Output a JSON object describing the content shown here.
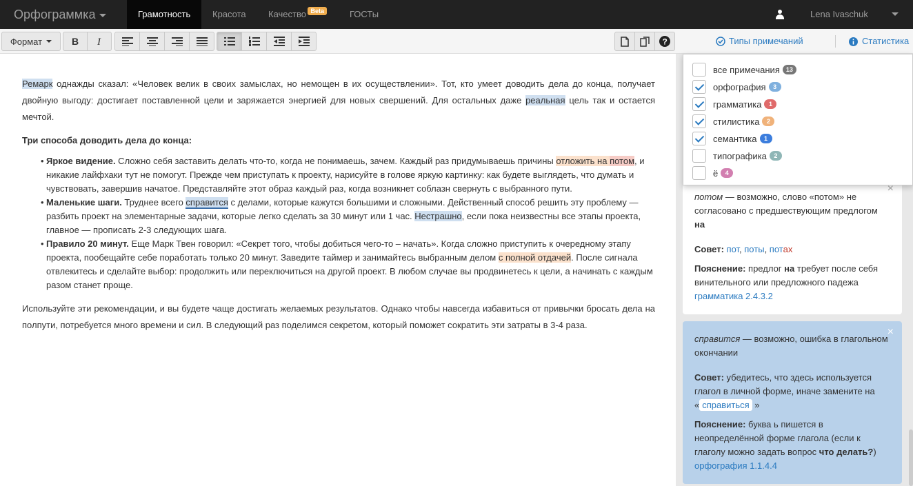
{
  "nav": {
    "brand": "Орфограммка",
    "tabs": [
      {
        "label": "Грамотность"
      },
      {
        "label": "Красота"
      },
      {
        "label": "Качество"
      },
      {
        "label": "ГОСТы"
      }
    ],
    "beta_badge": "Beta",
    "user_name": "Lena Ivaschuk"
  },
  "toolbar": {
    "format_label": "Формат",
    "buttons": [
      "bold",
      "italic",
      "align-left",
      "align-center",
      "align-right",
      "align-justify",
      "bullet-list",
      "numbered-list",
      "outdent",
      "indent"
    ],
    "comment_types_label": "Типы примечаний",
    "stats_label": "Статистика"
  },
  "editor": {
    "p1": {
      "w1": "Ремарк",
      "t1": " однажды сказал: «Человек велик в своих замыслах, но немощен в их осуществлении». Тот, кто умеет доводить дела до конца, получает двойную выгоду: достигает поставленной цели и заряжается энергией для новых свершений. Для остальных даже ",
      "w2": "реальная",
      "t2": " цель так и остается мечтой."
    },
    "heading": "Три способа доводить дела до конца:",
    "bullets": [
      {
        "bold": "Яркое видение.",
        "t1": " Сложно себя заставить делать что-то, когда не понимаешь, зачем. Каждый раз придумываешь причины ",
        "w1": "отложить на ",
        "w2": "потом",
        "t2": ", и никакие лайфхаки тут не помогут. Прежде чем приступать к проекту, нарисуйте в голове яркую картинку: как будете выглядеть, что думать и чувствовать, завершив начатое. Представляйте этот образ каждый раз, когда возникнет соблазн свернуть с выбранного пути."
      },
      {
        "bold": "Маленькие шаги.",
        "t1": " Труднее всего ",
        "w1": "справится",
        "t2": " с делами, которые кажутся большими и сложными. Действенный способ решить эту проблему — разбить проект на элементарные задачи, которые легко сделать за 30 минут или 1 час. ",
        "w2": "Нестрашно",
        "t3": ", если пока неизвестны все этапы проекта, главное — прописать 2-3 следующих шага."
      },
      {
        "bold": "Правило 20 минут.",
        "t1": " Еще Марк Твен говорил: «Секрет того, чтобы добиться чего-то – начать». Когда сложно приступить к очередному этапу проекта, пообещайте себе поработать только 20 минут. Заведите таймер и занимайтесь выбранным делом ",
        "w1": "с полной отдачей",
        "t2": ". После сигнала отвлекитесь и сделайте выбор: продолжить или переключиться на другой проект. В любом случае вы продвинетесь к цели, а начинать с каждым разом станет проще."
      }
    ],
    "p3": "Используйте эти рекомендации, и вы будете чаще достигать желаемых результатов. Однако чтобы навсегда избавиться от привычки бросать дела на полпути, потребуется много времени и сил. В следующий раз поделимся секретом, который поможет сократить эти затраты в 3-4 раза."
  },
  "filter": {
    "items": [
      {
        "label": "все примечания",
        "count": "13",
        "checked": false,
        "color": "#777777"
      },
      {
        "label": "орфография",
        "count": "3",
        "checked": true,
        "color": "#7fb0de"
      },
      {
        "label": "грамматика",
        "count": "1",
        "checked": true,
        "color": "#e06b6b"
      },
      {
        "label": "стилистика",
        "count": "2",
        "checked": true,
        "color": "#f0b27a"
      },
      {
        "label": "семантика",
        "count": "1",
        "checked": true,
        "color": "#3b7ddd"
      },
      {
        "label": "типографика",
        "count": "2",
        "checked": false,
        "color": "#8fb6b6"
      },
      {
        "label": "ё",
        "count": "4",
        "checked": false,
        "color": "#d27fb0"
      }
    ]
  },
  "cards": {
    "card1": {
      "word": "потом",
      "desc": " — возможно, слово «потом» не согласовано с предшествующим предлогом ",
      "desc_bold": "на",
      "advice_label": "Совет:",
      "options": [
        "пот",
        "поты",
        "потах"
      ],
      "explain_label": "Пояснение:",
      "explain_t1": " предлог ",
      "explain_bold": "на",
      "explain_t2": " требует после себя винительного или предложного падежа",
      "rule": "грамматика 2.4.3.2"
    },
    "card2": {
      "word": "справится",
      "desc": " — возможно, ошибка в глагольном окончании",
      "advice_label": "Совет:",
      "advice_text": " убедитесь, что здесь используется глагол в личной форме, иначе замените на «",
      "advice_option": "справиться",
      "advice_end": "»",
      "explain_label": "Пояснение:",
      "explain_text": " буква ь пишется в неопределённой форме глагола (если к глаголу можно задать вопрос ",
      "explain_bold": "что делать?",
      "explain_end": ")",
      "rule": "орфография 1.1.4.4"
    }
  }
}
